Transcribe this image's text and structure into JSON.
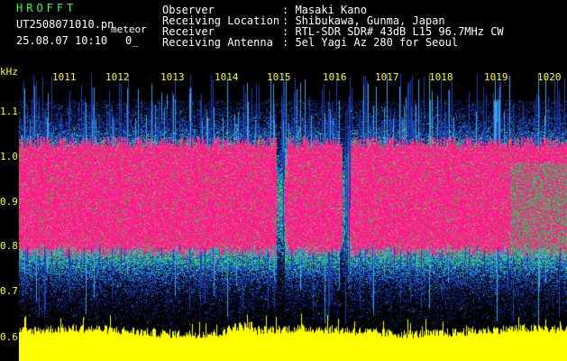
{
  "header": {
    "software": "HROFFT",
    "filename": "UT2508071010.pn",
    "tag": "meteor",
    "datetime": "25.08.07 10:10",
    "count": "0_",
    "fields": [
      {
        "label": "Observer",
        "value": ": Masaki Kano"
      },
      {
        "label": "Receiving Location",
        "value": ": Shibukawa, Gunma, Japan"
      },
      {
        "label": "Receiver",
        "value": ": RTL-SDR SDR# 43dB L15 96.7MHz CW"
      },
      {
        "label": "Receiving Antenna",
        "value": ": 5el Yagi Az 280 for Seoul"
      }
    ]
  },
  "y_axis": {
    "unit": "kHz",
    "ticks": [
      "1.1",
      "1.0",
      "0.9",
      "0.8",
      "0.7",
      "0.6"
    ]
  },
  "x_axis": {
    "ticks": [
      "1011",
      "1012",
      "1013",
      "1014",
      "1015",
      "1016",
      "1017",
      "1018",
      "1019",
      "1020"
    ]
  },
  "colors": {
    "background": "#000000",
    "noise": "#1030a0",
    "signal": "#ff1a8c",
    "power": "#ffff00",
    "label": "#ffff00"
  }
}
